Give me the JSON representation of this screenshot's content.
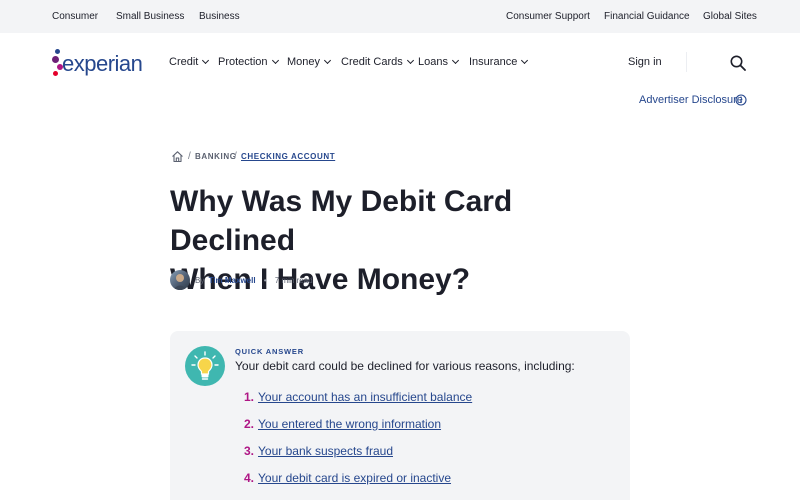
{
  "utility_nav": {
    "left": [
      "Consumer",
      "Small Business",
      "Business"
    ],
    "right": [
      "Consumer Support",
      "Financial Guidance",
      "Global Sites"
    ]
  },
  "logo": {
    "wordmark": "experian",
    "colors": [
      "#26478d",
      "#af1685",
      "#6d2077",
      "#e4002b"
    ]
  },
  "main_nav": {
    "items": [
      "Credit",
      "Protection",
      "Money",
      "Credit Cards",
      "Loans",
      "Insurance"
    ],
    "sign_in": "Sign in",
    "search_icon": "search-icon"
  },
  "advertiser_disclosure": {
    "label": "Advertiser Disclosure",
    "icon": "info-icon"
  },
  "breadcrumb": {
    "home_icon": "home-icon",
    "sep": "/",
    "items": [
      "BANKING",
      "CHECKING ACCOUNT"
    ]
  },
  "article": {
    "title_line1": "Why Was My Debit Card Declined",
    "title_line2": "When I Have Money?",
    "by": "By",
    "author": "Tim Maxwell",
    "read_time": "7 min read"
  },
  "quick_answer": {
    "label": "QUICK ANSWER",
    "intro": "Your debit card could be declined for various reasons, including:",
    "icon": "lightbulb-icon",
    "items": [
      {
        "num": "1.",
        "text": "Your account has an insufficient balance"
      },
      {
        "num": "2.",
        "text": "You entered the wrong information"
      },
      {
        "num": "3.",
        "text": "Your bank suspects fraud"
      },
      {
        "num": "4.",
        "text": "Your debit card is expired or inactive"
      }
    ]
  },
  "colors": {
    "brand_blue": "#26478d",
    "brand_magenta": "#af1685",
    "teal": "#3fb7b0",
    "light_gray": "#f3f4f6"
  }
}
